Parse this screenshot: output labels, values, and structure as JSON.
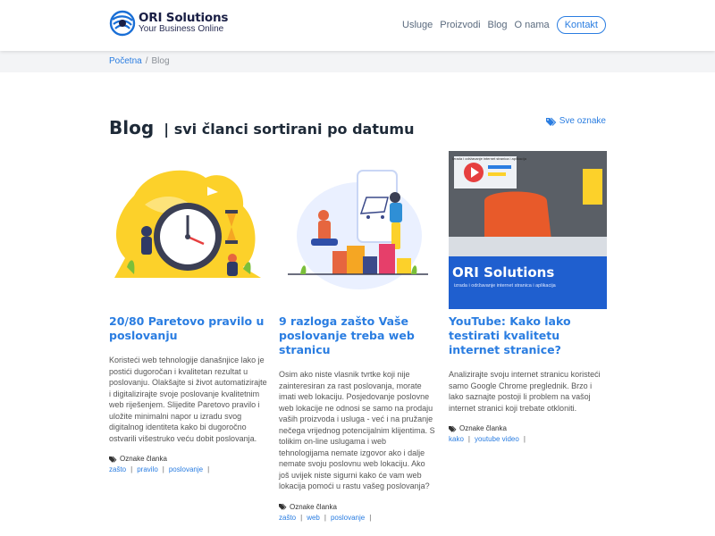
{
  "header": {
    "logo_name": "ORI Solutions",
    "logo_tagline": "Your Business Online",
    "nav": [
      "Usluge",
      "Proizvodi",
      "Blog",
      "O nama"
    ],
    "contact_label": "Kontakt",
    "accent_color": "#2a7de1"
  },
  "breadcrumb": {
    "home": "Početna",
    "separator": "/",
    "current": "Blog"
  },
  "page": {
    "title": "Blog",
    "subtitle": "| svi članci sortirani po datumu",
    "all_tags_label": "Sve oznake"
  },
  "cards": [
    {
      "title": "20/80 Paretovo pravilo u poslovanju",
      "excerpt": "Koristeći web tehnologije današnjice lako je postići dugoročan i kvalitetan rezultat u poslovanju. Olakšajte si život automatizirajte i digitalizirajte svoje poslovanje kvalitetnim web riješenjem. Slijedite Paretovo pravilo i uložite minimalni napor u izradu svog digitalnog identiteta kako bi dugoročno ostvarili višestruko veću dobit poslovanja.",
      "tags_label": "Oznake članka",
      "tags": [
        "zašto",
        "pravilo",
        "poslovanje"
      ],
      "image_icon": "clock-illustration"
    },
    {
      "title": "9 razloga zašto Vaše poslovanje treba web stranicu",
      "excerpt": "Osim ako niste vlasnik tvrtke koji nije zainteresiran za rast poslovanja, morate imati web lokaciju. Posjedovanje poslovne web lokacije ne odnosi se samo na prodaju vaših proizvoda i usluga - već i na pružanje nečega vrijednog potencijalnim klijentima. S tolikim on-line uslugama i web tehnologijama nemate izgovor ako i dalje nemate svoju poslovnu web lokaciju. Ako još uvijek niste sigurni kako će vam web lokacija pomoći u rastu vašeg poslovanja?",
      "tags_label": "Oznake članka",
      "tags": [
        "zašto",
        "web",
        "poslovanje"
      ],
      "image_icon": "shopping-illustration"
    },
    {
      "title": "YouTube: Kako lako testirati kvalitetu internet stranice?",
      "excerpt": "Analizirajte svoju internet stranicu koristeći samo Google Chrome preglednik. Brzo i lako saznajte postoji li problem na vašoj internet stranici koji trebate otkloniti.",
      "tags_label": "Oznake članka",
      "tags": [
        "kako",
        "youtube video"
      ],
      "image_icon": "video-thumbnail",
      "video_brand": "ORI Solutions",
      "video_caption": "izrada i održavanje internet stranica i aplikacija",
      "video_top_text": "Izrada i održavanje internet stranica i aplikacija"
    }
  ]
}
